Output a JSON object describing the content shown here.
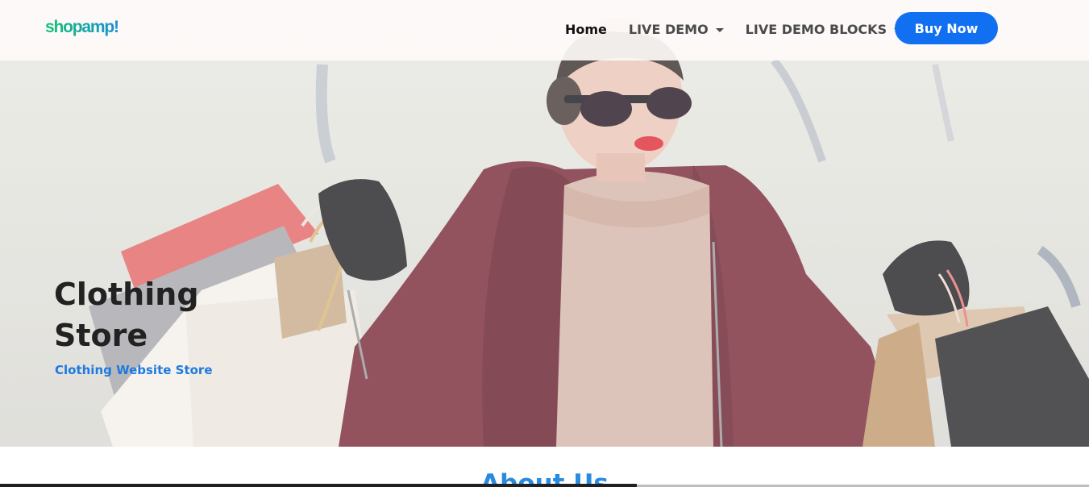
{
  "brand": {
    "logo_text": "shopamp!"
  },
  "nav": {
    "items": [
      {
        "label": "Home",
        "active": true,
        "dropdown": false
      },
      {
        "label": "LIVE DEMO",
        "active": false,
        "dropdown": true
      },
      {
        "label": "LIVE DEMO BLOCKS",
        "active": false,
        "dropdown": true
      }
    ],
    "cta_label": "Buy Now"
  },
  "hero": {
    "title": "Clothing Store",
    "subtitle": "Clothing Website Store"
  },
  "about": {
    "title": "About Us"
  },
  "colors": {
    "accent": "#1170f2",
    "subtitle": "#1f7ae0",
    "about_title": "#2a8ae0",
    "coat": "#7a2e3c"
  }
}
